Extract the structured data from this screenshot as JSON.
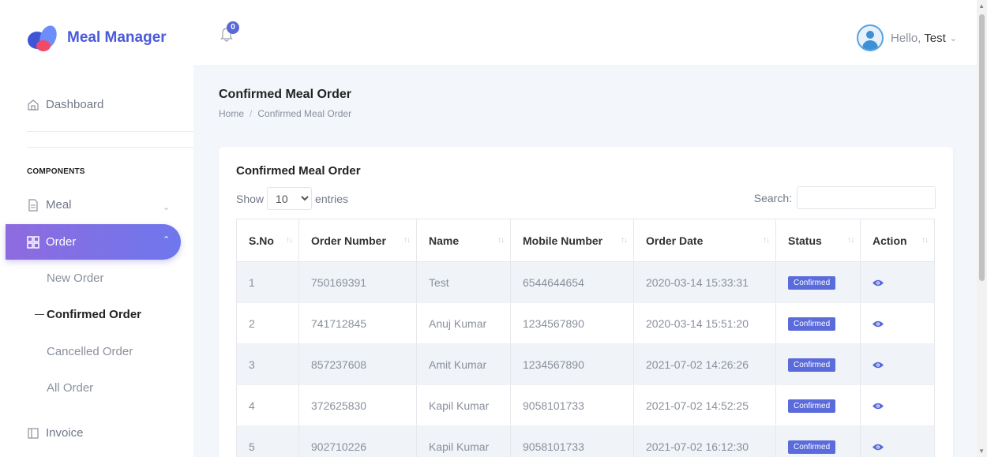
{
  "brand": {
    "name": "Meal Manager"
  },
  "sidebar": {
    "dashboard": "Dashboard",
    "section": "COMPONENTS",
    "meal": "Meal",
    "order": "Order",
    "sub_items": [
      "New Order",
      "Confirmed Order",
      "Cancelled Order",
      "All Order"
    ],
    "invoice": "Invoice"
  },
  "header": {
    "notification_count": "0",
    "greeting": "Hello,",
    "user_name": "Test"
  },
  "page": {
    "title": "Confirmed Meal Order",
    "breadcrumb": [
      "Home",
      "Confirmed Meal Order"
    ]
  },
  "card": {
    "title": "Confirmed Meal Order",
    "show_label": "Show",
    "entries_value": "10",
    "entries_label": "entries",
    "search_label": "Search:",
    "search_value": ""
  },
  "table": {
    "columns": [
      "S.No",
      "Order Number",
      "Name",
      "Mobile Number",
      "Order Date",
      "Status",
      "Action"
    ],
    "rows": [
      {
        "sno": "1",
        "order_number": "750169391",
        "name": "Test",
        "mobile": "6544644654",
        "date": "2020-03-14 15:33:31",
        "status": "Confirmed"
      },
      {
        "sno": "2",
        "order_number": "741712845",
        "name": "Anuj Kumar",
        "mobile": "1234567890",
        "date": "2020-03-14 15:51:20",
        "status": "Confirmed"
      },
      {
        "sno": "3",
        "order_number": "857237608",
        "name": "Amit Kumar",
        "mobile": "1234567890",
        "date": "2021-07-02 14:26:26",
        "status": "Confirmed"
      },
      {
        "sno": "4",
        "order_number": "372625830",
        "name": "Kapil Kumar",
        "mobile": "9058101733",
        "date": "2021-07-02 14:52:25",
        "status": "Confirmed"
      },
      {
        "sno": "5",
        "order_number": "902710226",
        "name": "Kapil Kumar",
        "mobile": "9058101733",
        "date": "2021-07-02 16:12:30",
        "status": "Confirmed"
      }
    ]
  },
  "colors": {
    "accent": "#5a6bdb",
    "brand": "#4a5ad9",
    "active_gradient_start": "#8e6bdf",
    "active_gradient_end": "#6e77ec"
  }
}
